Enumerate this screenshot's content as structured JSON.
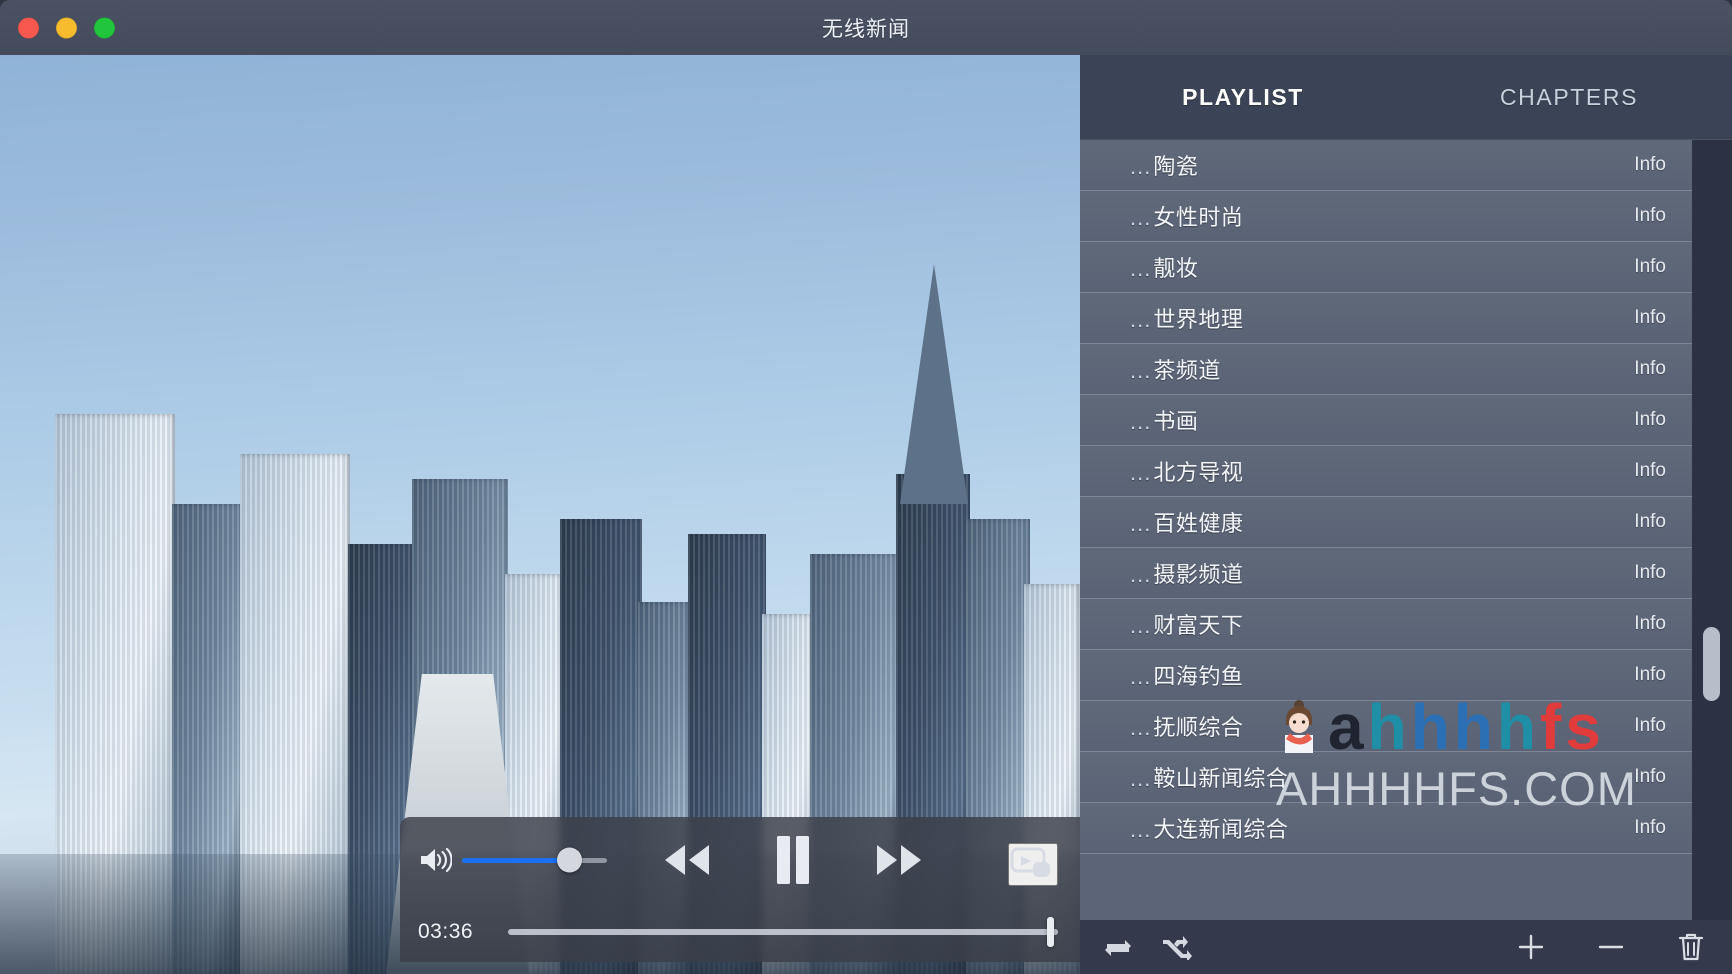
{
  "window": {
    "title": "无线新闻",
    "traffic_lights": [
      {
        "name": "close",
        "color": "#f9584f"
      },
      {
        "name": "minimize",
        "color": "#f7bc2e"
      },
      {
        "name": "maximize",
        "color": "#21c53b"
      }
    ]
  },
  "player": {
    "current_time": "03:36",
    "volume_percent": 74,
    "seek_percent": 99,
    "state": "playing",
    "icons": {
      "volume": "speaker-icon",
      "rewind": "rewind-icon",
      "pause": "pause-icon",
      "forward": "fast-forward-icon",
      "screen": "screen-share-icon"
    }
  },
  "sidebar": {
    "tabs": [
      {
        "label": "PLAYLIST",
        "active": true
      },
      {
        "label": "CHAPTERS",
        "active": false
      }
    ],
    "info_label": "Info",
    "item_prefix": "...",
    "items": [
      {
        "title": "陶瓷"
      },
      {
        "title": "女性时尚"
      },
      {
        "title": "靓妆"
      },
      {
        "title": "世界地理"
      },
      {
        "title": "茶频道"
      },
      {
        "title": "书画"
      },
      {
        "title": "北方导视"
      },
      {
        "title": "百姓健康"
      },
      {
        "title": "摄影频道"
      },
      {
        "title": "财富天下"
      },
      {
        "title": "四海钓鱼"
      },
      {
        "title": "抚顺综合"
      },
      {
        "title": "鞍山新闻综合"
      },
      {
        "title": "大连新闻综合"
      }
    ],
    "toolbar": {
      "loop_label": "loop-icon",
      "shuffle_label": "shuffle-icon",
      "add_label": "plus-icon",
      "remove_label": "minus-icon",
      "delete_label": "trash-icon"
    }
  },
  "watermark": {
    "brand_parts": [
      "a",
      "h",
      "h",
      "h",
      "h",
      "f",
      "s"
    ],
    "domain": "AHHHHFS.COM"
  },
  "colors": {
    "accent": "#1c6ef2",
    "titlebar": "#474f60",
    "sidebar": "#3c4354",
    "list": "#5c6577",
    "toolbar": "#343a4b"
  }
}
